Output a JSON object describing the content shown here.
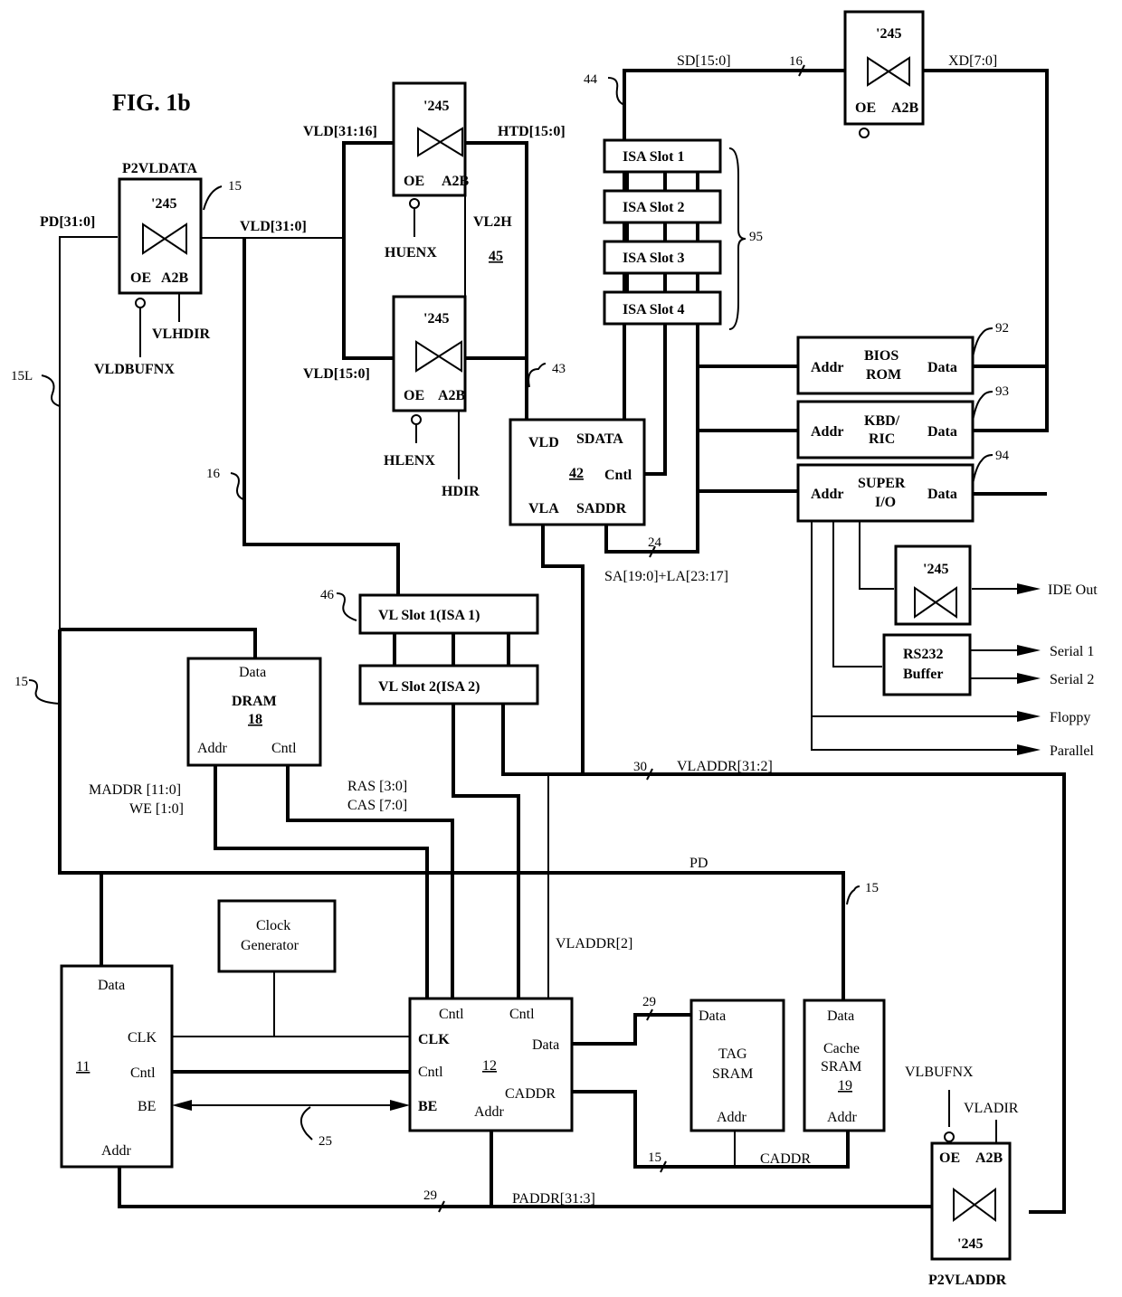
{
  "figure": {
    "title": "FIG. 1b"
  },
  "buffers": {
    "p2vldata": {
      "name": "P2VLDATA",
      "part": "'245",
      "oe": "OE",
      "a2b": "A2B",
      "ref": "15",
      "oe_signal": "VLDBUFNX",
      "dir_signal": "VLHDIR"
    },
    "upper": {
      "part": "'245",
      "oe": "OE",
      "a2b": "A2B",
      "oe_signal": "HUENX"
    },
    "lower": {
      "part": "'245",
      "oe": "OE",
      "a2b": "A2B",
      "oe_signal": "HLENX",
      "dir_signal": "HDIR"
    },
    "xd": {
      "part": "'245",
      "oe": "OE",
      "a2b": "A2B"
    },
    "ide": {
      "part": "'245"
    },
    "p2vladdr": {
      "name": "P2VLADDR",
      "part": "'245",
      "oe": "OE",
      "a2b": "A2B",
      "oe_signal": "VLBUFNX",
      "dir_signal": "VLADIR"
    }
  },
  "group_45": {
    "label": "VL2H",
    "ref": "45"
  },
  "controller_42": {
    "vld": "VLD",
    "sdata": "SDATA",
    "ref": "42",
    "cntl": "Cntl",
    "vla": "VLA",
    "saddr": "SADDR"
  },
  "isa_slots": {
    "items": [
      "ISA Slot 1",
      "ISA Slot 2",
      "ISA Slot 3",
      "ISA Slot 4"
    ],
    "ref": "95"
  },
  "peripherals": [
    {
      "addr": "Addr",
      "name1": "BIOS",
      "name2": "ROM",
      "data": "Data",
      "ref": "92"
    },
    {
      "addr": "Addr",
      "name1": "KBD/",
      "name2": "RIC",
      "data": "Data",
      "ref": "93"
    },
    {
      "addr": "Addr",
      "name1": "SUPER",
      "name2": "I/O",
      "data": "Data",
      "ref": "94"
    }
  ],
  "rs232": {
    "line1": "RS232",
    "line2": "Buffer"
  },
  "outputs": {
    "ide": "IDE Out",
    "serial1": "Serial 1",
    "serial2": "Serial 2",
    "floppy": "Floppy",
    "parallel": "Parallel"
  },
  "vl_slots": {
    "items": [
      "VL Slot 1(ISA 1)",
      "VL Slot 2(ISA 2)"
    ],
    "ref": "46"
  },
  "dram": {
    "data": "Data",
    "name": "DRAM",
    "ref": "18",
    "addr": "Addr",
    "cntl": "Cntl"
  },
  "cpu_11": {
    "data": "Data",
    "clk": "CLK",
    "ref": "11",
    "cntl": "Cntl",
    "be": "BE",
    "addr": "Addr"
  },
  "clock": {
    "line1": "Clock",
    "line2": "Generator"
  },
  "chipset_12": {
    "cntl1": "Cntl",
    "cntl2": "Cntl",
    "clk": "CLK",
    "data": "Data",
    "cntl": "Cntl",
    "ref": "12",
    "caddr": "CADDR",
    "be": "BE",
    "addr": "Addr"
  },
  "tag_sram": {
    "data": "Data",
    "line1": "TAG",
    "line2": "SRAM",
    "addr": "Addr"
  },
  "cache_sram": {
    "data": "Data",
    "line1": "Cache",
    "line2": "SRAM",
    "ref": "19",
    "addr": "Addr"
  },
  "signals": {
    "pd_31_0": "PD[31:0]",
    "vld_31_0": "VLD[31:0]",
    "vld_31_16": "VLD[31:16]",
    "vld_15_0": "VLD[15:0]",
    "htd_15_0": "HTD[15:0]",
    "sd_15_0": "SD[15:0]",
    "xd_7_0": "XD[7:0]",
    "sa_la": "SA[19:0]+LA[23:17]",
    "vladdr_31_2": "VLADDR[31:2]",
    "vladdr_2": "VLADDR[2]",
    "maddr": "MADDR [11:0]",
    "we": "WE [1:0]",
    "ras": "RAS [3:0]",
    "cas": "CAS [7:0]",
    "pd": "PD",
    "caddr": "CADDR",
    "paddr": "PADDR[31:3]"
  },
  "refs": {
    "r15L": "15L",
    "r15_left": "15",
    "r16": "16",
    "r43": "43",
    "r44": "44",
    "bus16": "16",
    "bus24": "24",
    "bus30": "30",
    "r15_pd": "15",
    "bus29_tag": "29",
    "bus15_caddr": "15",
    "bus29_paddr": "29",
    "r25": "25"
  }
}
